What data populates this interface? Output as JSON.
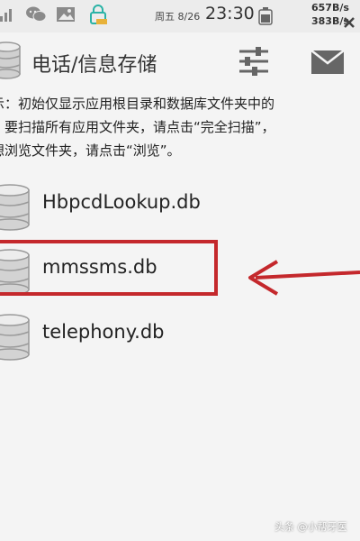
{
  "status_bar": {
    "day_date": "周五 8/26",
    "time": "23:30",
    "net_up": "657B/s",
    "net_down": "383B/s",
    "icons": [
      "signal-icon",
      "wechat-icon",
      "photo-icon",
      "lock-notification-icon",
      "battery-icon",
      "close-icon"
    ]
  },
  "toolbar": {
    "title": "电话/信息存储",
    "icons": [
      "database-icon",
      "filter-sliders-icon",
      "mail-icon"
    ]
  },
  "notice": {
    "lines": [
      "示：初始仅显示应用根目录和数据库文件夹中的",
      "，要扫描所有应用文件夹，请点击“完全扫描”，",
      "想浏览文件夹，请点击“浏览”。"
    ]
  },
  "files": [
    {
      "name": "HbpcdLookup.db"
    },
    {
      "name": "mmssms.db"
    },
    {
      "name": "telephony.db"
    }
  ],
  "annotation": {
    "highlight_color": "#c4282c",
    "highlighted_item": "mmssms.db"
  },
  "watermark": "头条 @小帮牙医"
}
